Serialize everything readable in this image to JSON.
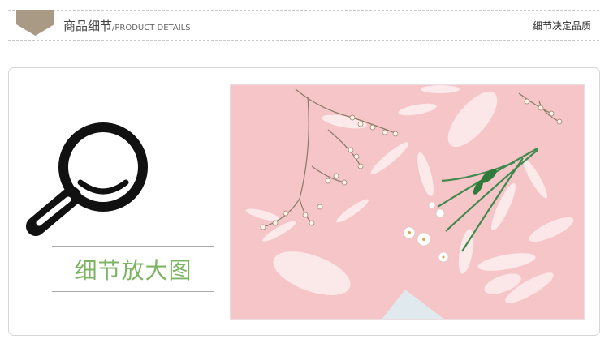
{
  "header": {
    "title": "商品细节",
    "subtitle": "/PRODUCT DETAILS",
    "right_text": "细节决定品质",
    "badge_color": "#a89a85"
  },
  "panel": {
    "icon": "magnifier-icon",
    "label": "细节放大图",
    "label_color": "#7cb461"
  },
  "photo": {
    "subject": "flowers-and-petals-on-pink",
    "background_color": "#f5c5c8"
  }
}
